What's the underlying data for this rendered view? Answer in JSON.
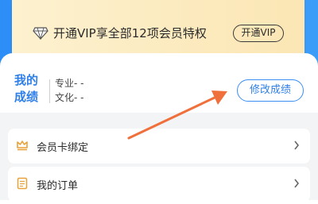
{
  "vip_banner": {
    "text": "开通VIP享全部12项会员特权",
    "button_label": "开通VIP"
  },
  "scores": {
    "title": "我的成绩",
    "major": "专业- -",
    "culture": "文化- -",
    "edit_button_label": "修改成绩"
  },
  "menu": {
    "items": [
      {
        "label": "会员卡绑定",
        "icon": "crown-icon"
      },
      {
        "label": "我的订单",
        "icon": "document-icon"
      }
    ]
  },
  "colors": {
    "primary_blue": "#2f7fe8",
    "vip_gold": "#fbe6b4",
    "arrow_orange": "#f0703c"
  }
}
